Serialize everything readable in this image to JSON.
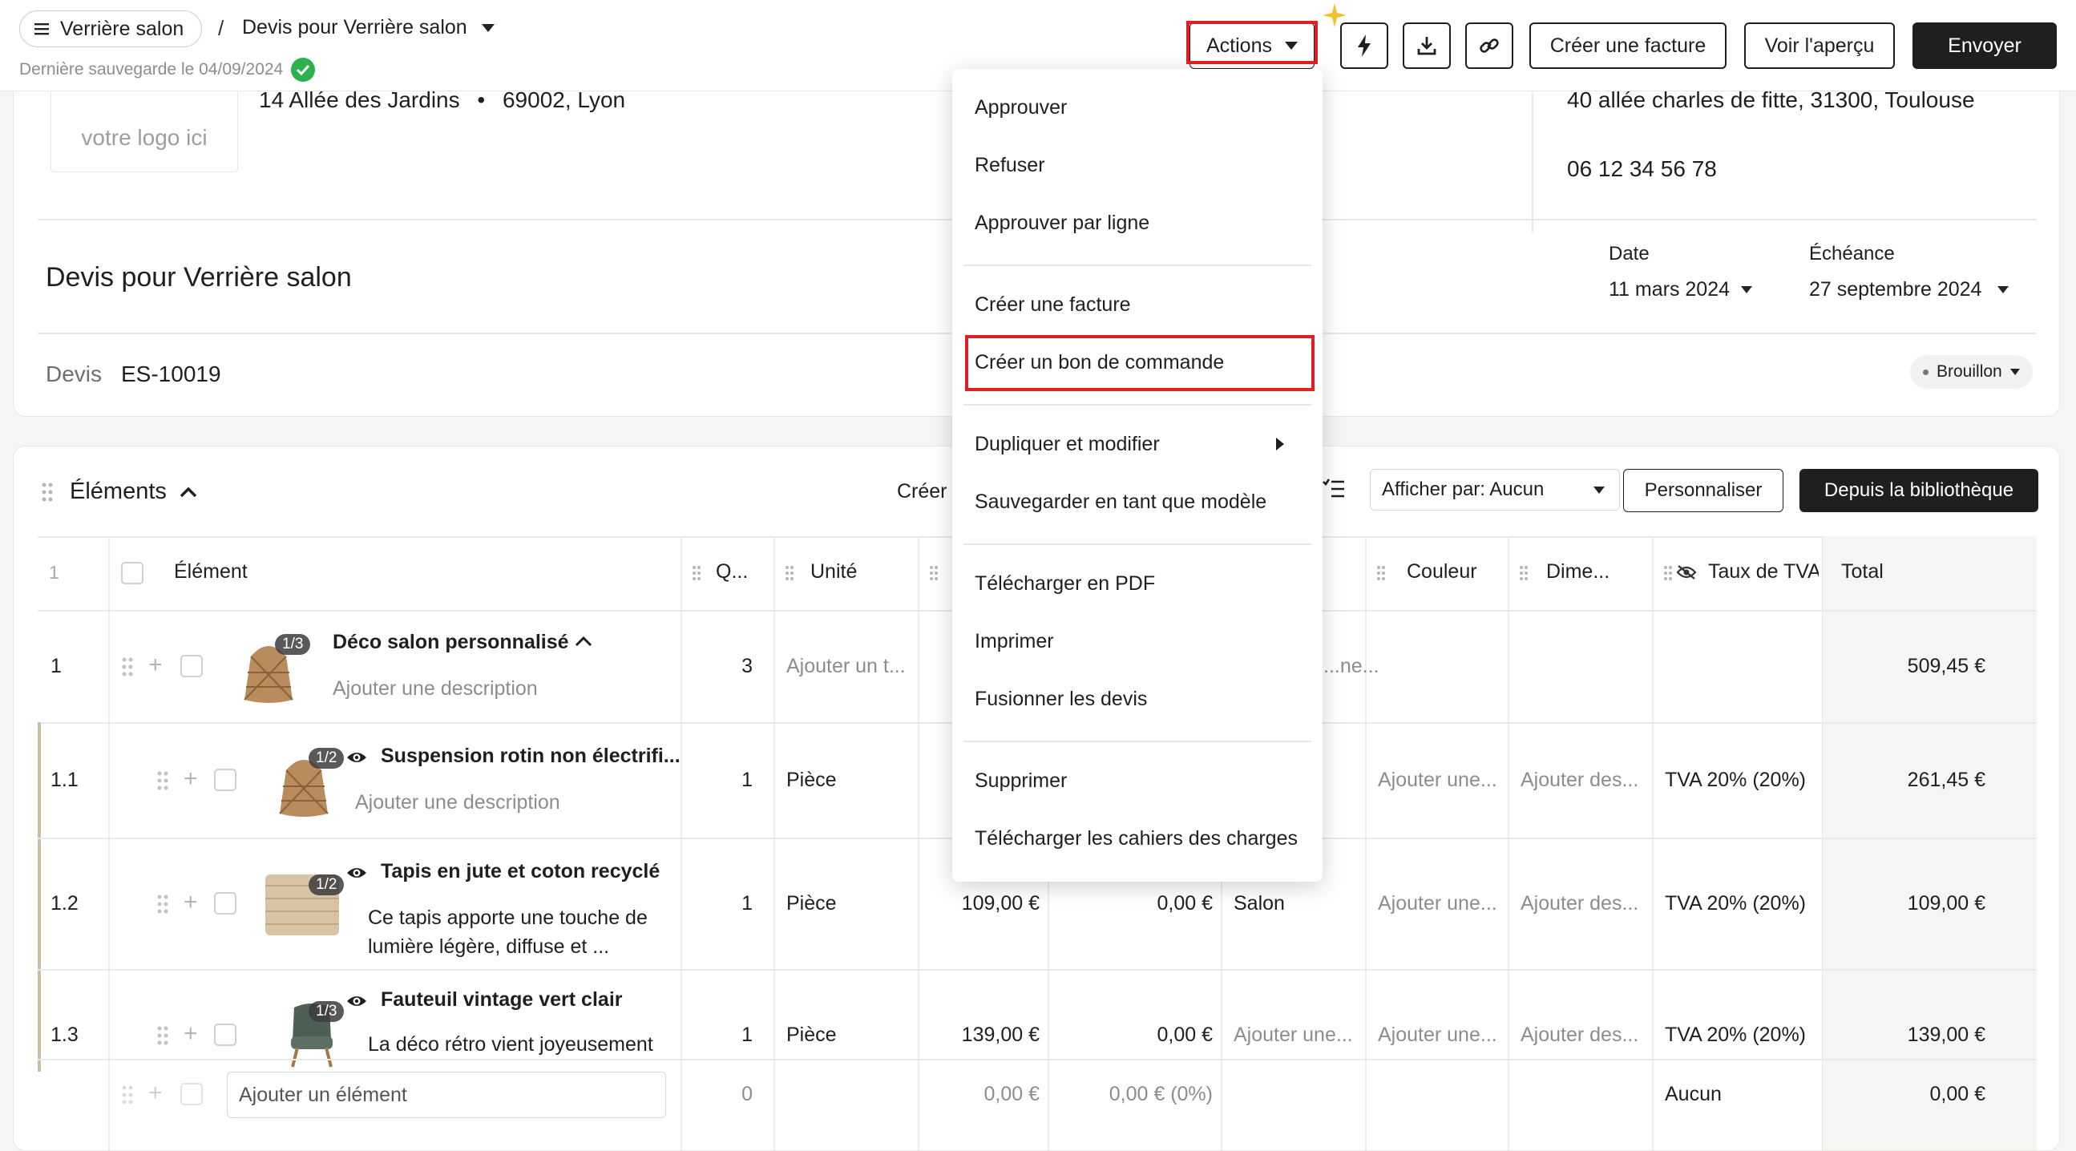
{
  "header": {
    "project_label": "Verrière salon",
    "separator": "/",
    "doc_title": "Devis pour Verrière salon",
    "last_save": "Dernière sauvegarde le 04/09/2024",
    "actions_label": "Actions",
    "create_invoice_label": "Créer une facture",
    "preview_label": "Voir l'aperçu",
    "send_label": "Envoyer"
  },
  "company": {
    "logo_placeholder": "votre logo ici",
    "address_street": "14 Allée des Jardins",
    "address_dot": "•",
    "address_city": "69002, Lyon"
  },
  "client": {
    "address": "40 allée charles de fitte, 31300, Toulouse",
    "phone": "06 12 34 56 78"
  },
  "quote": {
    "title": "Devis pour Verrière salon",
    "date_label": "Date",
    "date_value": "11 mars 2024",
    "due_label": "Échéance",
    "due_value": "27 septembre 2024",
    "type_label": "Devis",
    "number": "ES-10019",
    "status": "Brouillon"
  },
  "elements": {
    "title": "Éléments",
    "create_label": "Créer",
    "display_by": "Afficher par: Aucun",
    "customize_label": "Personnaliser",
    "library_label": "Depuis la bibliothèque",
    "columns": {
      "index": "1",
      "element": "Élément",
      "qty": "Q...",
      "unit": "Unité",
      "color": "Couleur",
      "dimensions": "Dime...",
      "vat": "Taux de TVA",
      "total": "Total"
    },
    "rows": [
      {
        "index": "1",
        "badge": "1/3",
        "name": "Déco salon personnalisé",
        "desc": "Ajouter une description",
        "qty": "3",
        "unit": "Ajouter un t...",
        "room": "...ne...",
        "total": "509,45 €"
      },
      {
        "index": "1.1",
        "badge": "1/2",
        "name": "Suspension rotin non électrifi...",
        "desc": "Ajouter une description",
        "qty": "1",
        "unit": "Pièce",
        "color": "Ajouter une...",
        "dim": "Ajouter des...",
        "vat": "TVA 20% (20%)",
        "total": "261,45 €"
      },
      {
        "index": "1.2",
        "badge": "1/2",
        "name": "Tapis en jute et coton recyclé",
        "desc1": "Ce tapis apporte une touche de",
        "desc2": "lumière légère, diffuse et ...",
        "qty": "1",
        "unit": "Pièce",
        "price": "109,00 €",
        "discount": "0,00 €",
        "room": "Salon",
        "color": "Ajouter une...",
        "dim": "Ajouter des...",
        "vat": "TVA 20% (20%)",
        "total": "109,00 €"
      },
      {
        "index": "1.3",
        "badge": "1/3",
        "name": "Fauteuil vintage vert clair",
        "desc": "La déco rétro vient joyeusement",
        "qty": "1",
        "unit": "Pièce",
        "price": "139,00 €",
        "discount": "0,00 €",
        "room": "Ajouter une...",
        "color": "Ajouter une...",
        "dim": "Ajouter des...",
        "vat": "TVA 20% (20%)",
        "total": "139,00 €"
      }
    ],
    "add_row": {
      "placeholder": "Ajouter un élément",
      "qty": "0",
      "price": "0,00 €",
      "discount": "0,00 € (0%)",
      "vat": "Aucun",
      "total": "0,00 €"
    }
  },
  "menu": {
    "items": [
      "Approuver",
      "Refuser",
      "Approuver par ligne",
      "Créer une facture",
      "Créer un bon de commande",
      "Dupliquer et modifier",
      "Sauvegarder en tant que modèle",
      "Télécharger en PDF",
      "Imprimer",
      "Fusionner les devis",
      "Supprimer",
      "Télécharger les cahiers des charges"
    ]
  },
  "colors": {
    "accent_red": "#e02020",
    "success_green": "#2bb24c",
    "dark_button": "#1f1f1f"
  }
}
